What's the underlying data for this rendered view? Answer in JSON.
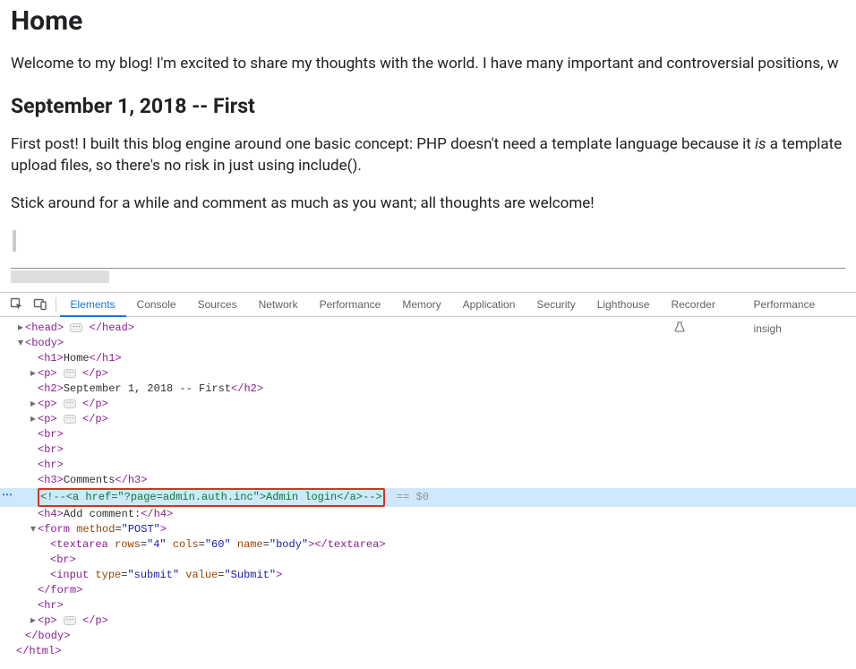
{
  "page": {
    "h1": "Home",
    "intro": "Welcome to my blog! I'm excited to share my thoughts with the world. I have many important and controversial positions, w",
    "h2": "September 1, 2018 -- First",
    "body_pre": "First post! I built this blog engine around one basic concept: PHP doesn't need a template language because it ",
    "body_is": "is",
    "body_post": " a template",
    "body_line2": "upload files, so there's no risk in just using include().",
    "stick": "Stick around for a while and comment as much as you want; all thoughts are welcome!"
  },
  "devtools": {
    "tabs": [
      "Elements",
      "Console",
      "Sources",
      "Network",
      "Performance",
      "Memory",
      "Application",
      "Security",
      "Lighthouse",
      "Recorder",
      "Performance insigh"
    ]
  },
  "tree": {
    "head_open": "<head>",
    "head_close": "</head>",
    "body_open": "<body>",
    "h1_open": "<h1>",
    "h1_text": "Home",
    "h1_close": "</h1>",
    "p_open": "<p>",
    "p_close": "</p>",
    "h2_open": "<h2>",
    "h2_text": "September 1, 2018 -- First",
    "h2_close": "</h2>",
    "br": "<br>",
    "hr": "<hr>",
    "h3_open": "<h3>",
    "h3_text": "Comments",
    "h3_close": "</h3>",
    "comment_pre": "<!--",
    "comment_inner": "<a href=\"?page=admin.auth.inc\">Admin login</a>",
    "comment_post": "-->",
    "eq0": " == $0",
    "h4_open": "<h4>",
    "h4_text": "Add comment:",
    "h4_close": "</h4>",
    "form_open_a": "<form ",
    "form_method_n": "method",
    "form_method_v": "\"POST\"",
    "close_gt": ">",
    "ta_open": "<textarea ",
    "ta_rows_n": "rows",
    "ta_rows_v": "\"4\"",
    "ta_cols_n": "cols",
    "ta_cols_v": "\"60\"",
    "ta_name_n": "name",
    "ta_name_v": "\"body\"",
    "ta_close": "</textarea>",
    "inp_open": "<input ",
    "inp_type_n": "type",
    "inp_type_v": "\"submit\"",
    "inp_val_n": "value",
    "inp_val_v": "\"Submit\"",
    "form_close": "</form>",
    "body_close": "</body>",
    "html_close": "</html>"
  }
}
